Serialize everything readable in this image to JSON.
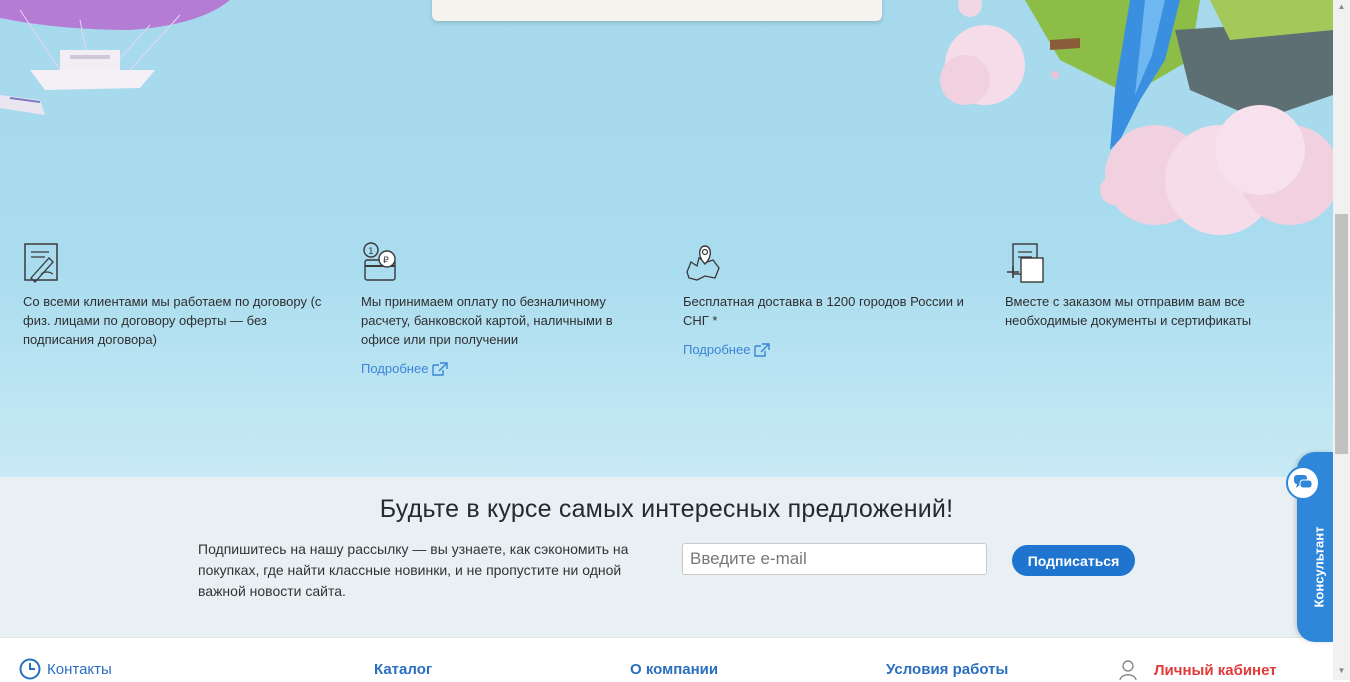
{
  "features": [
    {
      "icon": "contract-icon",
      "text": "Со всеми клиентами мы работаем по договору (с физ. лицами по договору оферты — без подписания договора)"
    },
    {
      "icon": "payment-card-icon",
      "text": "Мы принимаем оплату по безналичному расчету, банковской картой, наличными в офисе или при получении",
      "link": "Подробнее"
    },
    {
      "icon": "map-pin-icon",
      "text": "Бесплатная доставка в 1200 городов России и СНГ *",
      "link": "Подробнее"
    },
    {
      "icon": "documents-icon",
      "text": "Вместе с заказом мы отправим вам все необходимые документы и сертификаты"
    }
  ],
  "subscribe": {
    "title": "Будьте в курсе самых интересных предложений!",
    "description": "Подпишитесь на нашу рассылку — вы узнаете, как сэкономить на покупках, где найти классные новинки, и не пропустите ни одной важной новости сайта.",
    "email_placeholder": "Введите e-mail",
    "button_label": "Подписаться"
  },
  "footer": {
    "contacts": "Контакты",
    "catalog": "Каталог",
    "about": "О компании",
    "terms": "Условия работы",
    "cabinet": "Личный кабинет"
  },
  "consultant": {
    "label": "Консультант"
  },
  "colors": {
    "accent": "#1e74cf",
    "link": "#3b85d6",
    "cabinet": "#e03a3a",
    "hero_bg": "#a9dcef"
  }
}
